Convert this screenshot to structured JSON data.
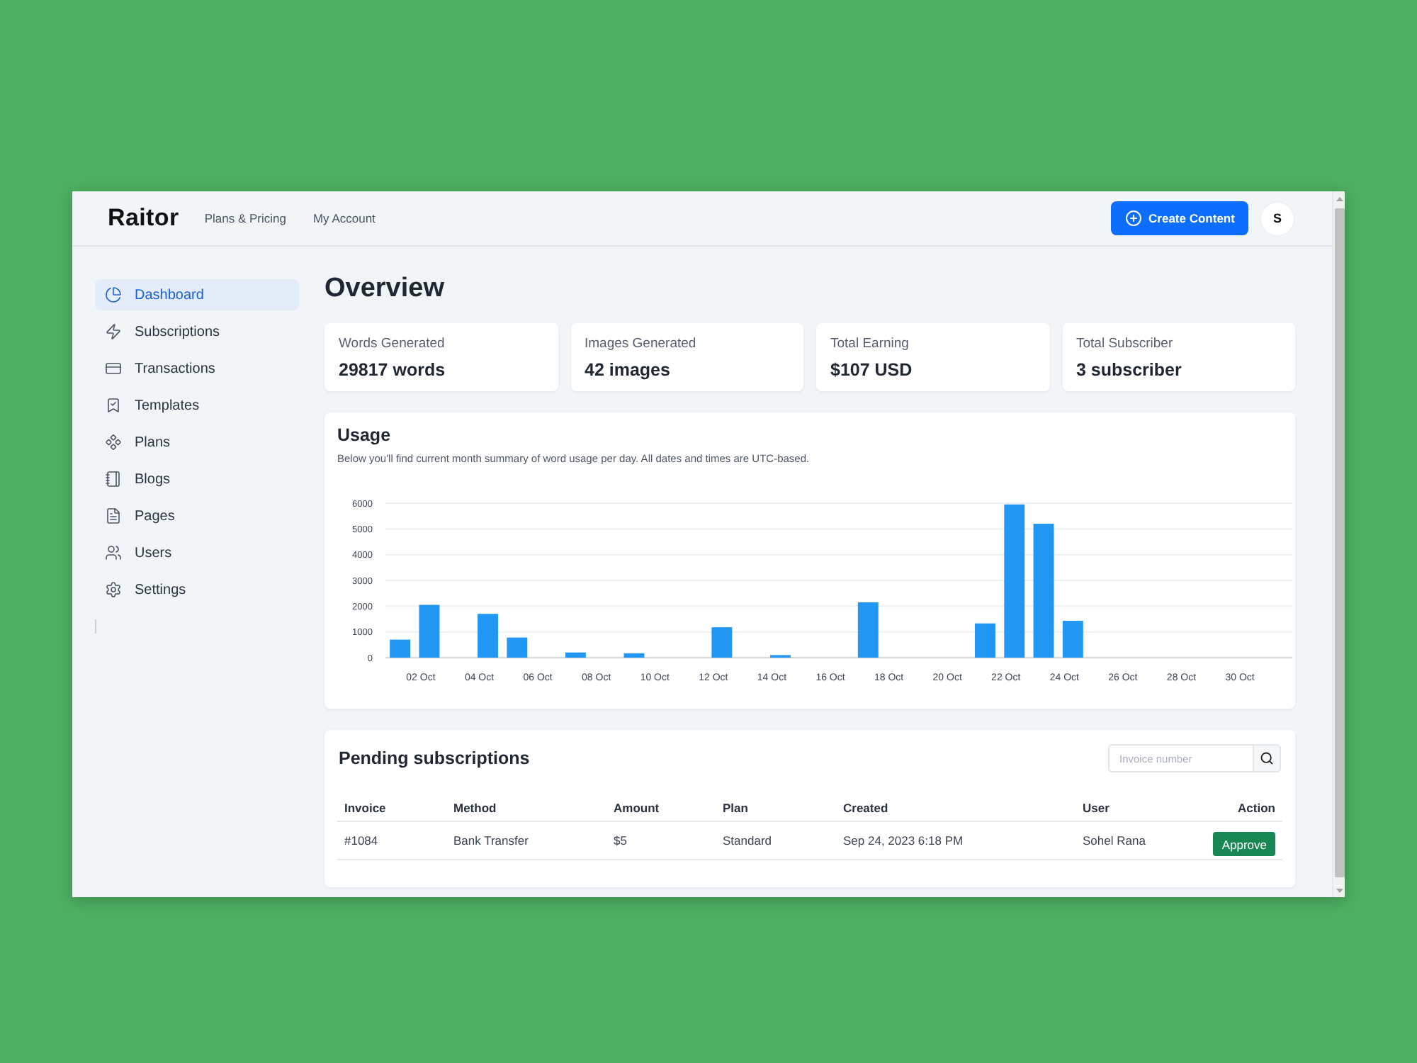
{
  "header": {
    "logo": "**R**aitor",
    "nav": [
      "Plans & Pricing",
      "My Account"
    ],
    "create_button": "Create Content",
    "avatar": "S"
  },
  "sidebar": {
    "items": [
      {
        "label": "Dashboard",
        "selected": true
      },
      {
        "label": "Subscriptions",
        "selected": false
      },
      {
        "label": "Transactions",
        "selected": false
      },
      {
        "label": "Templates",
        "selected": false
      },
      {
        "label": "Plans",
        "selected": false
      },
      {
        "label": "Blogs",
        "selected": false
      },
      {
        "label": "Pages",
        "selected": false
      },
      {
        "label": "Users",
        "selected": false
      },
      {
        "label": "Settings",
        "selected": false
      }
    ]
  },
  "page_title": "Overview",
  "stats": [
    {
      "label": "Words Generated",
      "value": "29817 words"
    },
    {
      "label": "Images Generated",
      "value": "42 images"
    },
    {
      "label": "Total Earning",
      "value": "$107 USD"
    },
    {
      "label": "Total Subscriber",
      "value": "3 subscriber"
    }
  ],
  "usage": {
    "title": "Usage",
    "description": "Below you'll find current month summary of word usage per day. All dates and times are UTC-based.",
    "chart_data": {
      "type": "bar",
      "categories": [
        null,
        "02 Oct",
        null,
        "04 Oct",
        null,
        "06 Oct",
        null,
        "08 Oct",
        null,
        "10 Oct",
        null,
        "12 Oct",
        null,
        "14 Oct",
        null,
        "16 Oct",
        null,
        "18 Oct",
        null,
        "20 Oct",
        null,
        "22 Oct",
        null,
        "24 Oct",
        null,
        "26 Oct",
        null,
        "28 Oct",
        null,
        "30 Oct",
        null
      ],
      "values": [
        700,
        2050,
        0,
        1700,
        780,
        0,
        200,
        0,
        170,
        0,
        0,
        1180,
        0,
        100,
        0,
        0,
        2150,
        0,
        0,
        0,
        1330,
        5950,
        5200,
        1430,
        0,
        0,
        0,
        0,
        0,
        0,
        0
      ],
      "ylim": [
        0,
        6000
      ],
      "yticks": [
        0,
        1000,
        2000,
        3000,
        4000,
        5000,
        6000
      ],
      "grid": true
    }
  },
  "pending": {
    "title": "Pending subscriptions",
    "search": {
      "placeholder": "Invoice number"
    },
    "table": {
      "columns": [
        "Invoice",
        "Method",
        "Amount",
        "Plan",
        "Created",
        "User",
        "Action"
      ],
      "rows": [
        {
          "cells": [
            "#1084",
            "Bank Transfer",
            "$5",
            "Standard",
            "Sep 24, 2023 6:18 PM",
            "Sohel Rana"
          ],
          "action": "Approve"
        }
      ]
    }
  }
}
